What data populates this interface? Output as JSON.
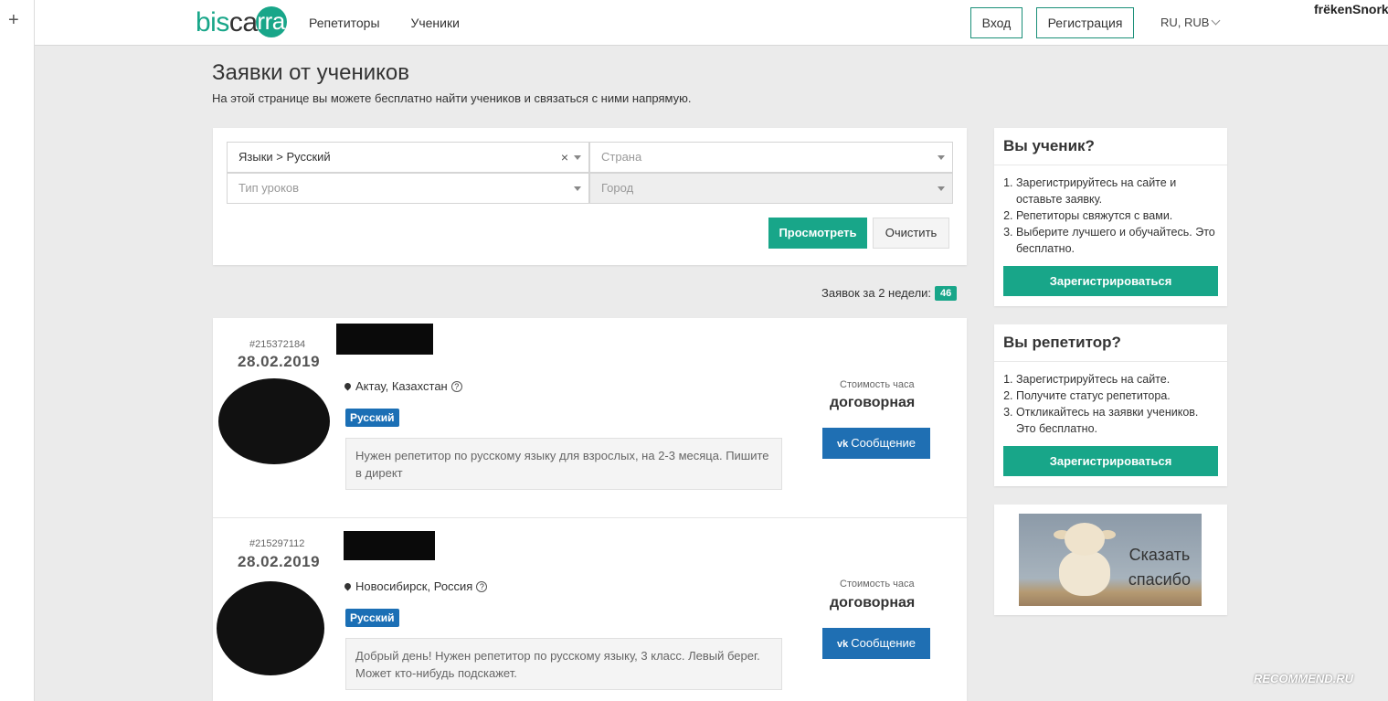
{
  "header": {
    "logo": {
      "part1": "bis",
      "part2": "ca",
      "part3": "rra"
    },
    "nav": [
      "Репетиторы",
      "Ученики"
    ],
    "login_label": "Вход",
    "register_label": "Регистрация",
    "lang_label": "RU, RUB",
    "username": "frëkenSnork"
  },
  "page": {
    "title": "Заявки от учеников",
    "subtitle": "На этой странице вы можете бесплатно найти учеников и связаться с ними напрямую."
  },
  "filter": {
    "subject_value": "Языки > Русский",
    "country_placeholder": "Страна",
    "lesson_type_placeholder": "Тип уроков",
    "city_placeholder": "Город",
    "view_label": "Просмотреть",
    "clear_label": "Очистить",
    "clear_x": "×"
  },
  "summary": {
    "label": "Заявок за 2 недели:",
    "count": "46"
  },
  "requests": [
    {
      "id": "#215372184",
      "date": "28.02.2019",
      "location": "Актау, Казахстан",
      "tag": "Русский",
      "message": "Нужен репетитор по русскому языку для взрослых, на 2-3 месяца. Пишите в директ",
      "price_label": "Стоимость часа",
      "price": "договорная",
      "vk_icon": "vk",
      "button_label": "Сообщение"
    },
    {
      "id": "#215297112",
      "date": "28.02.2019",
      "location": "Новосибирск, Россия",
      "tag": "Русский",
      "message": "Добрый день! Нужен репетитор по русскому языку, 3 класс. Левый берег. Может кто-нибудь подскажет.",
      "price_label": "Стоимость часа",
      "price": "договорная",
      "vk_icon": "vk",
      "button_label": "Сообщение"
    }
  ],
  "sidebar": {
    "student": {
      "title": "Вы ученик?",
      "steps": [
        "Зарегистрируйтесь на сайте и оставьте заявку.",
        "Репетиторы свяжутся с вами.",
        "Выберите лучшего и обучайтесь. Это бесплатно."
      ],
      "button": "Зарегистрироваться"
    },
    "tutor": {
      "title": "Вы репетитор?",
      "steps": [
        "Зарегистрируйтесь на сайте.",
        "Получите статус репетитора.",
        "Откликайтесь на заявки учеников. Это бесплатно."
      ],
      "button": "Зарегистрироваться"
    },
    "thanks": {
      "line1": "Сказать",
      "line2": "спасибо"
    }
  },
  "watermark": "RECOMMEND.RU",
  "colors": {
    "accent": "#18a689",
    "vk": "#1f6fb3",
    "tag": "#1b6fb5"
  }
}
